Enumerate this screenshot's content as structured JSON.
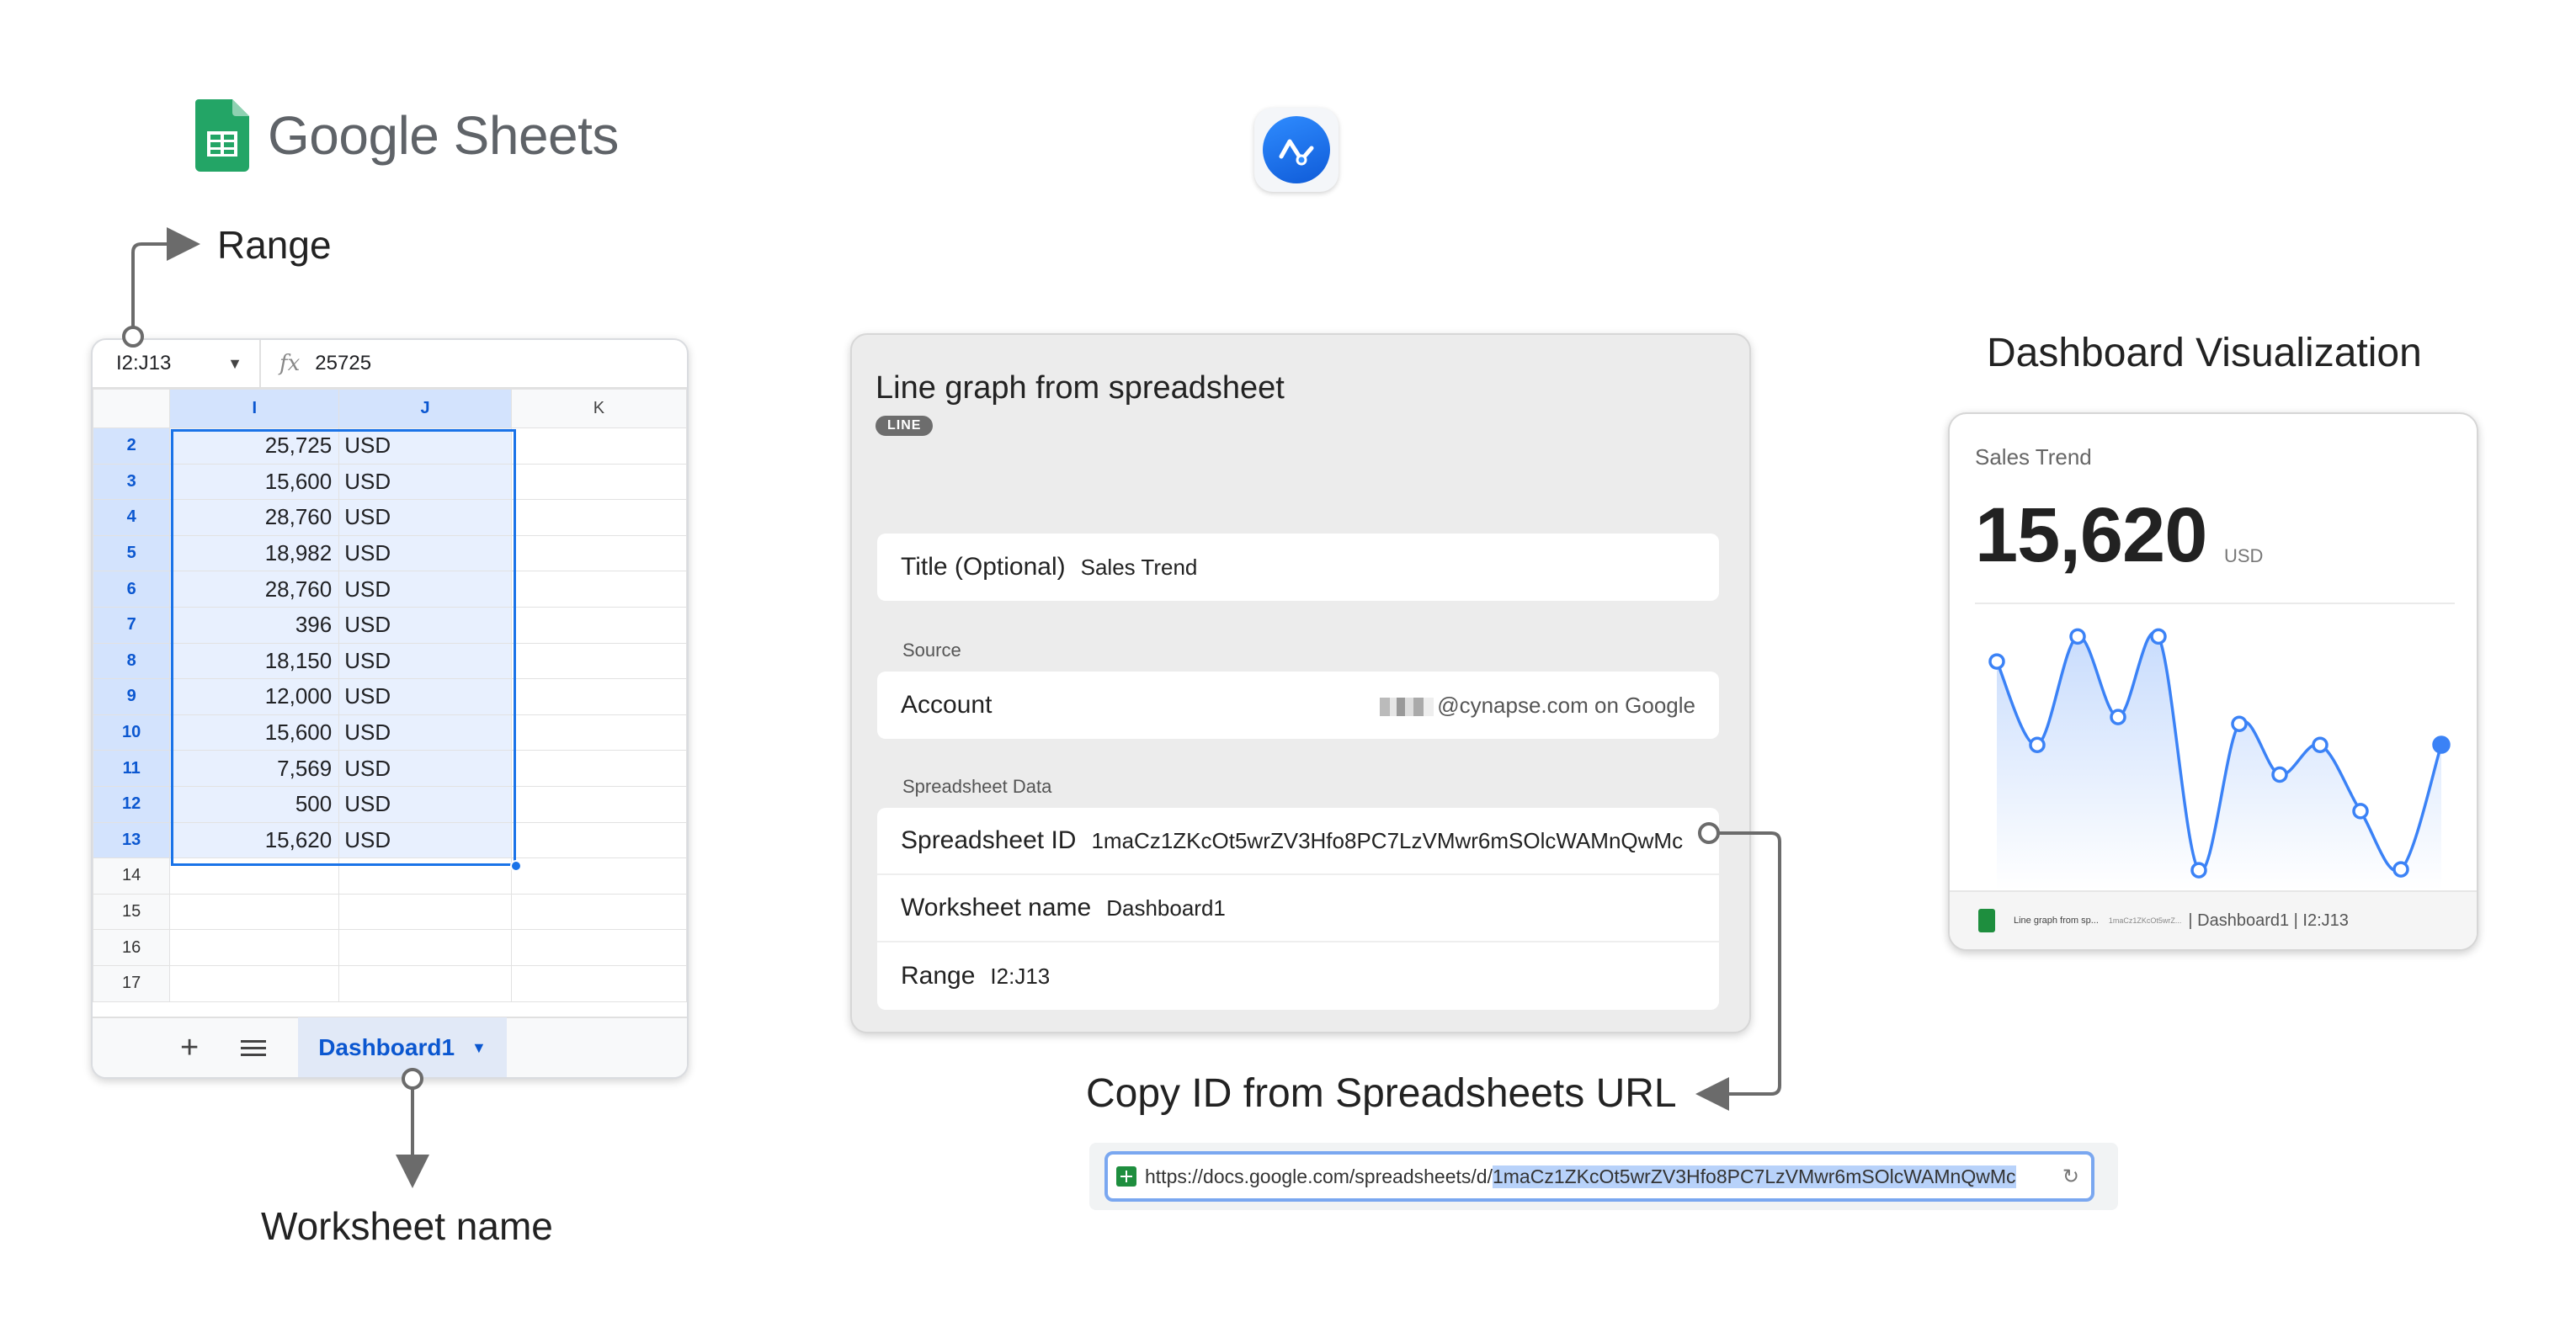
{
  "branding": {
    "google_sheets_text": "Google Sheets"
  },
  "callouts": {
    "range": "Range",
    "worksheet_name": "Worksheet name",
    "copy_id": "Copy ID from Spreadsheets URL",
    "dashboard_visualization": "Dashboard Visualization"
  },
  "sheet": {
    "name_box": "I2:J13",
    "formula_value": "25725",
    "columns": [
      "I",
      "J",
      "K"
    ],
    "rows": [
      {
        "row": "2",
        "value": "25,725",
        "unit": "USD"
      },
      {
        "row": "3",
        "value": "15,600",
        "unit": "USD"
      },
      {
        "row": "4",
        "value": "28,760",
        "unit": "USD"
      },
      {
        "row": "5",
        "value": "18,982",
        "unit": "USD"
      },
      {
        "row": "6",
        "value": "28,760",
        "unit": "USD"
      },
      {
        "row": "7",
        "value": "396",
        "unit": "USD"
      },
      {
        "row": "8",
        "value": "18,150",
        "unit": "USD"
      },
      {
        "row": "9",
        "value": "12,000",
        "unit": "USD"
      },
      {
        "row": "10",
        "value": "15,600",
        "unit": "USD"
      },
      {
        "row": "11",
        "value": "7,569",
        "unit": "USD"
      },
      {
        "row": "12",
        "value": "500",
        "unit": "USD"
      },
      {
        "row": "13",
        "value": "15,620",
        "unit": "USD"
      },
      {
        "row": "14",
        "value": "",
        "unit": ""
      },
      {
        "row": "15",
        "value": "",
        "unit": ""
      },
      {
        "row": "16",
        "value": "",
        "unit": ""
      },
      {
        "row": "17",
        "value": "",
        "unit": ""
      }
    ],
    "active_tab": "Dashboard1"
  },
  "panel": {
    "title": "Line graph from spreadsheet",
    "badge": "LINE",
    "title_field": {
      "label": "Title (Optional)",
      "value": "Sales Trend"
    },
    "source_section": "Source",
    "account": {
      "label": "Account",
      "value": "@cynapse.com on Google"
    },
    "data_section": "Spreadsheet Data",
    "spreadsheet_id": {
      "label": "Spreadsheet ID",
      "value": "1maCz1ZKcOt5wrZV3Hfo8PC7LzVMwr6mSOlcWAMnQwMc"
    },
    "worksheet": {
      "label": "Worksheet name",
      "value": "Dashboard1"
    },
    "range": {
      "label": "Range",
      "value": "I2:J13"
    }
  },
  "url": {
    "prefix": "https://docs.google.com/spreadsheets/d/",
    "id": "1maCz1ZKcOt5wrZV3Hfo8PC7LzVMwr6mSOlcWAMnQwMc"
  },
  "card": {
    "title": "Sales Trend",
    "value": "15,620",
    "unit": "USD",
    "footer_source": "Line graph from sp...",
    "footer_id": "1maCz1ZKcOt5wrZ...",
    "footer_meta": "| Dashboard1 | I2:J13",
    "accent_color": "#3b82f6"
  },
  "chart_data": {
    "type": "area",
    "x": [
      2,
      3,
      4,
      5,
      6,
      7,
      8,
      9,
      10,
      11,
      12,
      13
    ],
    "values": [
      25725,
      15600,
      28760,
      18982,
      28760,
      396,
      18150,
      12000,
      15600,
      7569,
      500,
      15620
    ],
    "ylim": [
      0,
      29000
    ],
    "grid": false,
    "legend": "none"
  }
}
